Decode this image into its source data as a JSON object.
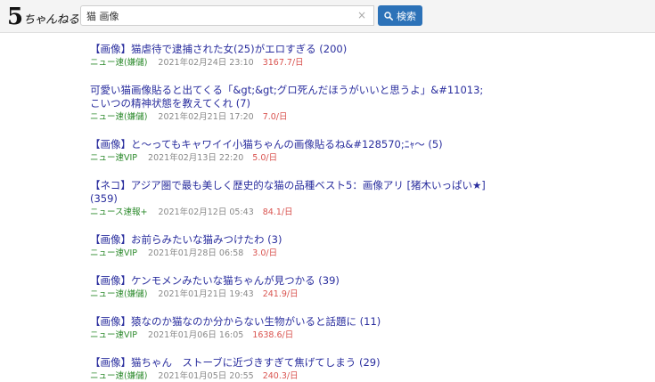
{
  "logo": {
    "num": "5",
    "text": "ちゃんねる"
  },
  "search": {
    "value": "猫 画像",
    "clear_label": "×",
    "button_label": "検索"
  },
  "results": [
    {
      "title": "【画像】猫虐待で逮捕された女(25)がエロすぎる (200)",
      "board": "ニュー速(嫌儲)",
      "date": "2021年02月24日 23:10",
      "speed": "3167.7/日"
    },
    {
      "title": "可愛い猫画像貼ると出てくる「&gt;&gt;グロ死んだほうがいいと思うよ」&#11013;こいつの精神状態を教えてくれ (7)",
      "board": "ニュー速(嫌儲)",
      "date": "2021年02月21日 17:20",
      "speed": "7.0/日"
    },
    {
      "title": "【画像】と～ってもキャワイイ小猫ちゃんの画像貼るね&#128570;ﾆｬ～ (5)",
      "board": "ニュー速VIP",
      "date": "2021年02月13日 22:20",
      "speed": "5.0/日"
    },
    {
      "title": "【ネコ】アジア圏で最も美しく歴史的な猫の品種ベスト5：画像アリ [猪木いっぱい★] (359)",
      "board": "ニュース速報+",
      "date": "2021年02月12日 05:43",
      "speed": "84.1/日"
    },
    {
      "title": "【画像】お前らみたいな猫みつけたわ (3)",
      "board": "ニュー速VIP",
      "date": "2021年01月28日 06:58",
      "speed": "3.0/日"
    },
    {
      "title": "【画像】ケンモメンみたいな猫ちゃんが見つかる (39)",
      "board": "ニュー速(嫌儲)",
      "date": "2021年01月21日 19:43",
      "speed": "241.9/日"
    },
    {
      "title": "【画像】猿なのか猫なのか分からない生物がいると話題に (11)",
      "board": "ニュー速VIP",
      "date": "2021年01月06日 16:05",
      "speed": "1638.6/日"
    },
    {
      "title": "【画像】猫ちゃん　ストーブに近づきすぎて焦げてしまう (29)",
      "board": "ニュー速(嫌儲)",
      "date": "2021年01月05日 20:55",
      "speed": "240.3/日"
    }
  ]
}
